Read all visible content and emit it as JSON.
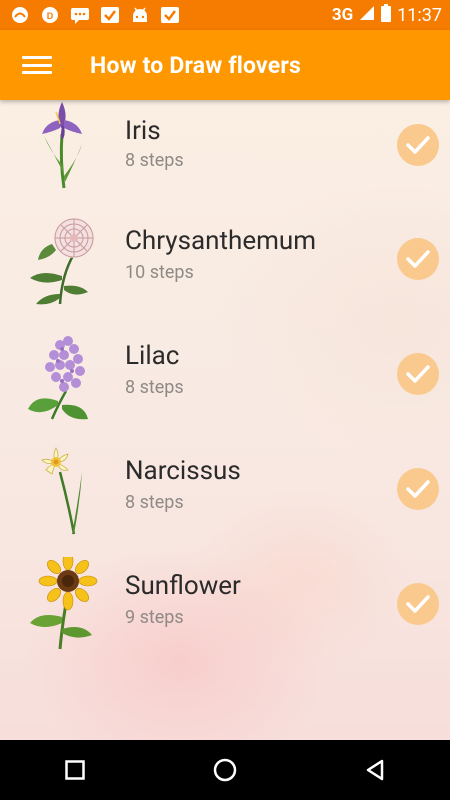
{
  "status_bar": {
    "network": "3G",
    "time": "11:37"
  },
  "app_bar": {
    "title": "How to Draw flovers"
  },
  "flowers": [
    {
      "name": "Iris",
      "steps": "8 steps",
      "icon": "iris-icon"
    },
    {
      "name": "Chrysanthemum",
      "steps": "10 steps",
      "icon": "chrysanthemum-icon"
    },
    {
      "name": "Lilac",
      "steps": "8 steps",
      "icon": "lilac-icon"
    },
    {
      "name": "Narcissus",
      "steps": "8 steps",
      "icon": "narcissus-icon"
    },
    {
      "name": "Sunflower",
      "steps": "9 steps",
      "icon": "sunflower-icon"
    }
  ],
  "colors": {
    "status_bar": "#f57c00",
    "app_bar": "#ff9800",
    "check_badge": "#f9c98e"
  }
}
